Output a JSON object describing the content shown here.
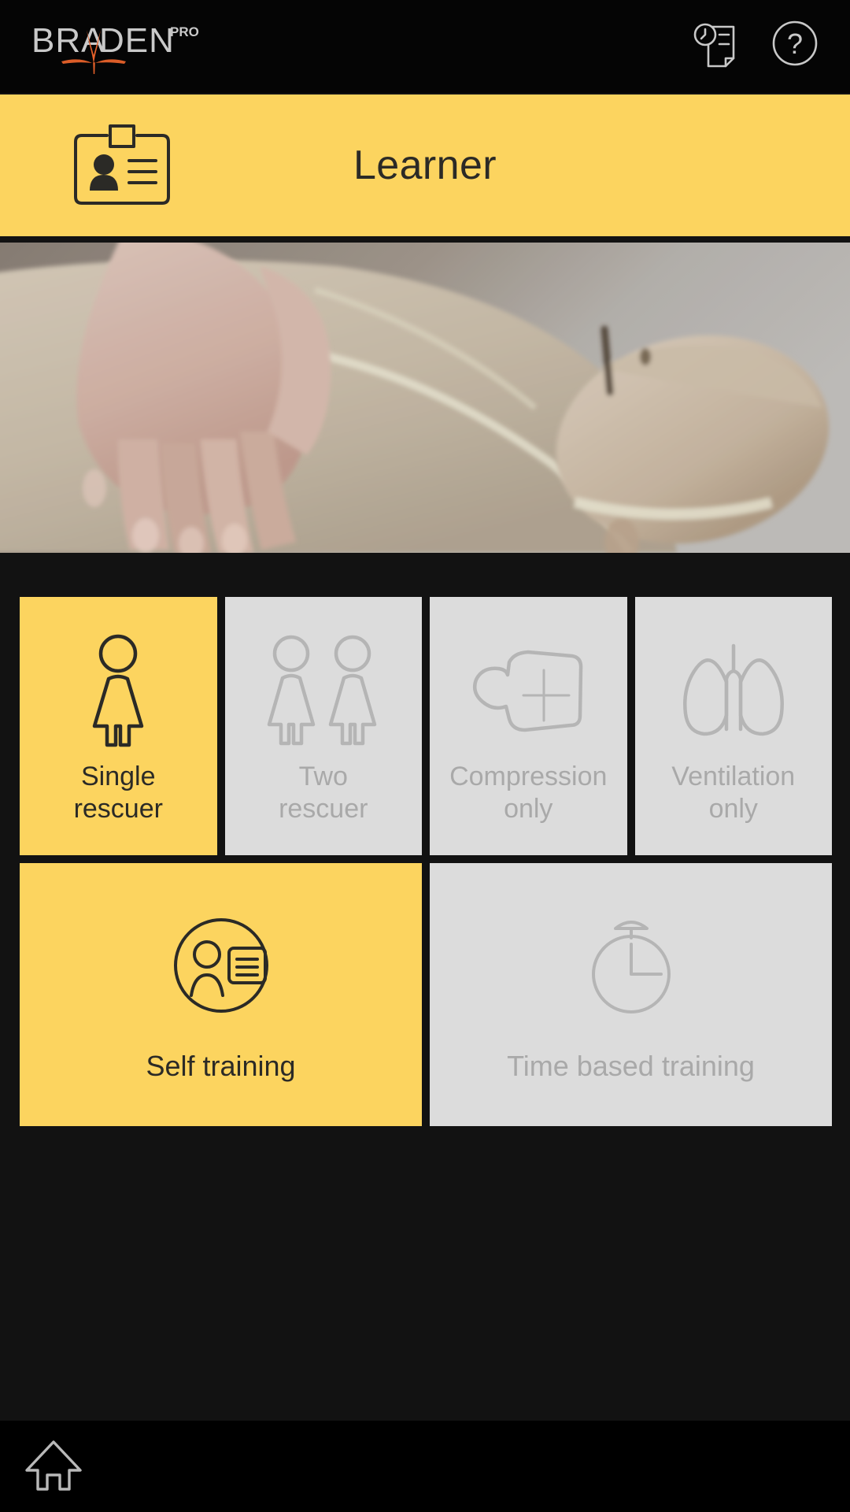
{
  "app": {
    "brand_name": "BRAYDEN",
    "brand_suffix": "PRO",
    "accent_yellow": "#FCD45F",
    "tile_grey": "#DCDCDC",
    "background_black": "#121212",
    "disabled_text": "#A9A9A9",
    "active_text": "#2b2a26"
  },
  "topbar": {
    "logo_name": "brayden-pro-logo",
    "actions": [
      {
        "name": "session-history-icon",
        "label": "Session history"
      },
      {
        "name": "help-icon",
        "label": "Help"
      }
    ]
  },
  "header": {
    "icon_name": "id-badge-icon",
    "title": "Learner"
  },
  "media": {
    "name": "cpr-training-video",
    "description": "Hands performing chest compressions on a CPR manikin"
  },
  "modes": [
    {
      "id": "single-rescuer",
      "label": "Single\nrescuer",
      "icon": "single-person-icon",
      "enabled": true,
      "selected": true
    },
    {
      "id": "two-rescuer",
      "label": "Two\nrescuer",
      "icon": "two-persons-icon",
      "enabled": false,
      "selected": false
    },
    {
      "id": "compression-only",
      "label": "Compression\nonly",
      "icon": "chest-compression-icon",
      "enabled": false,
      "selected": false
    },
    {
      "id": "ventilation-only",
      "label": "Ventilation\nonly",
      "icon": "lungs-icon",
      "enabled": false,
      "selected": false
    }
  ],
  "training_types": [
    {
      "id": "self-training",
      "label": "Self training",
      "icon": "self-training-icon",
      "enabled": true,
      "selected": true
    },
    {
      "id": "time-based-training",
      "label": "Time based training",
      "icon": "stopwatch-icon",
      "enabled": false,
      "selected": false
    }
  ],
  "bottomnav": {
    "items": [
      {
        "id": "home",
        "icon": "home-icon",
        "label": "Home"
      }
    ]
  }
}
